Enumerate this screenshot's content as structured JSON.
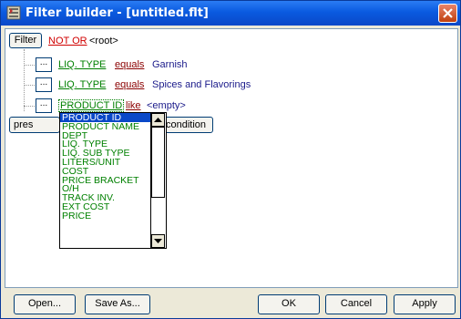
{
  "window": {
    "title": "Filter builder - [untitled.flt]"
  },
  "tree": {
    "root_button": "Filter",
    "root_operator": "NOT OR",
    "root_label": "<root>",
    "rows": [
      {
        "field": "LIQ. TYPE",
        "op": "equals",
        "value": "Garnish"
      },
      {
        "field": "LIQ. TYPE",
        "op": "equals",
        "value": "Spices and Flavorings"
      },
      {
        "field": "PRODUCT ID",
        "op": "like",
        "value": "<empty>"
      }
    ],
    "ellipsis": "...",
    "press_button": "pres",
    "add_condition": "condition"
  },
  "dropdown": {
    "items": [
      "PRODUCT ID",
      "PRODUCT NAME",
      "DEPT",
      "LIQ. TYPE",
      "LIQ. SUB TYPE",
      "LITERS/UNIT",
      "COST",
      "PRICE BRACKET",
      "O/H",
      "TRACK INV.",
      "EXT COST",
      "PRICE"
    ],
    "selected_index": 0
  },
  "footer": {
    "open": "Open...",
    "save_as": "Save As...",
    "ok": "OK",
    "cancel": "Cancel",
    "apply": "Apply"
  },
  "colors": {
    "title_bar": "#0a5ae0",
    "operator": "#d00000",
    "field": "#008000",
    "selection": "#0a48c8"
  }
}
